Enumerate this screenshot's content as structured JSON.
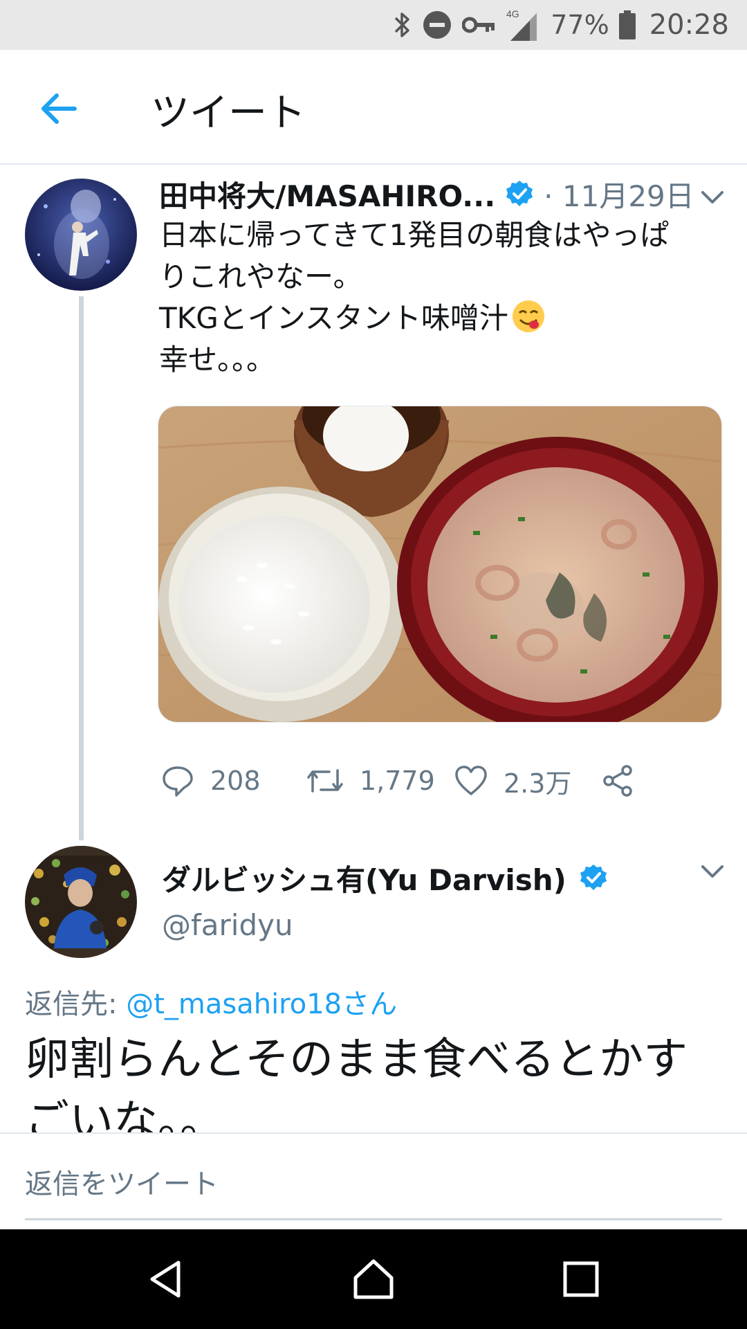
{
  "status_bar": {
    "network": "4G",
    "battery_percent": "77%",
    "time": "20:28",
    "icons": [
      "bluetooth-icon",
      "do-not-disturb-icon",
      "vpn-key-icon",
      "signal-icon",
      "battery-icon"
    ]
  },
  "header": {
    "title": "ツイート",
    "back_icon": "back-arrow-icon"
  },
  "tweet1": {
    "author_name": "田中将大/MASAHIRO...",
    "verified": true,
    "separator": "·",
    "date": "11月29日",
    "text_lines": [
      "日本に帰ってきて1発目の朝食はやっぱ",
      "りこれやなー。",
      "TKGとインスタント味噌汁",
      "幸せ。。。"
    ],
    "emoji": "yum-face-emoji",
    "media_description_icon": "breakfast-photo",
    "actions": {
      "reply_count": "208",
      "retweet_count": "1,779",
      "like_count": "2.3万"
    }
  },
  "tweet2": {
    "author_name": "ダルビッシュ有(Yu Darvish)",
    "verified": true,
    "handle": "@faridyu",
    "reply_prefix": "返信先:",
    "reply_to": "@t_masahiro18さん",
    "text": "卵割らんとそのまま食べるとかすごいな。。"
  },
  "compose": {
    "placeholder": "返信をツイート"
  },
  "colors": {
    "accent": "#1da1f2",
    "secondary_text": "#657786",
    "primary_text": "#14171a",
    "divider": "#e1e8ed"
  }
}
